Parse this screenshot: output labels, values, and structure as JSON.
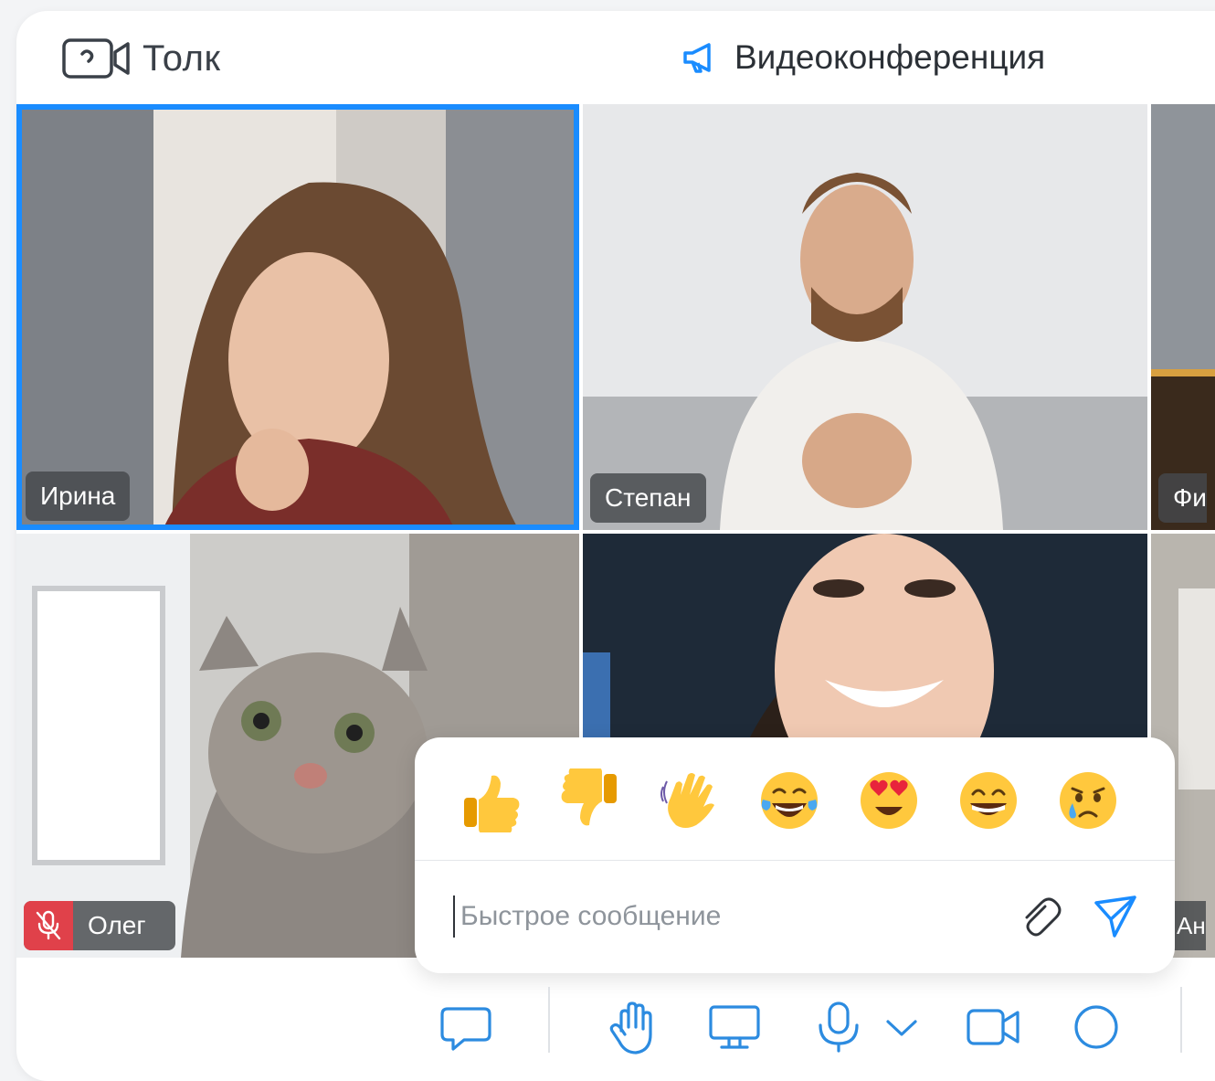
{
  "app": {
    "name": "Толк"
  },
  "header": {
    "conference_title": "Видеоконференция"
  },
  "participants": [
    {
      "name": "Ирина",
      "active": true,
      "muted": false
    },
    {
      "name": "Степан",
      "active": false,
      "muted": false
    },
    {
      "name": "Фи",
      "active": false,
      "muted": false
    },
    {
      "name": "Олег",
      "active": false,
      "muted": true
    },
    {
      "name": "",
      "active": false,
      "muted": false
    },
    {
      "name": "Ан",
      "active": false,
      "muted": false
    }
  ],
  "reactions": {
    "emojis": [
      "👍",
      "👎",
      "👋",
      "😂",
      "😍",
      "😁",
      "😢"
    ],
    "message": {
      "placeholder": "Быстрое сообщение",
      "value": ""
    }
  },
  "toolbar": {
    "buttons": [
      "chat-icon",
      "raise-hand-icon",
      "screen-share-icon",
      "microphone-icon",
      "chevron-down-icon",
      "camera-icon",
      "record-icon"
    ]
  },
  "colors": {
    "accent": "#1a8cff",
    "mute": "#e0414a",
    "icon_stroke": "#2c8be0"
  }
}
